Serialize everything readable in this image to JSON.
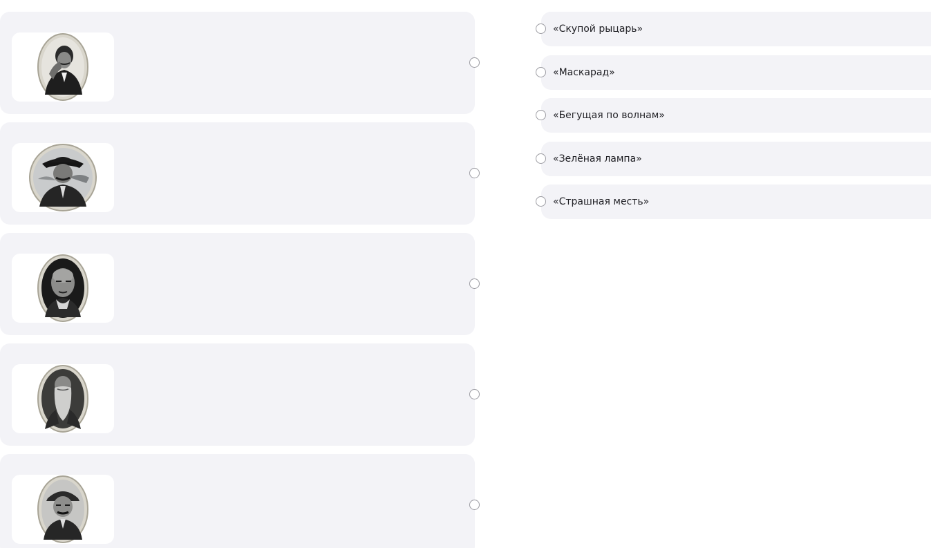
{
  "portraits": [
    {
      "icon": "portrait-man-mustache-hand-on-cheek-icon"
    },
    {
      "icon": "portrait-man-hat-mustache-icon"
    },
    {
      "icon": "portrait-man-bald-icon"
    },
    {
      "icon": "portrait-man-long-beard-icon"
    },
    {
      "icon": "portrait-man-cap-mustache-icon"
    }
  ],
  "options": [
    {
      "label": "«Скупой рыцарь»"
    },
    {
      "label": "«Маскарад»"
    },
    {
      "label": "«Бегущая по волнам»"
    },
    {
      "label": "«Зелёная лампа»"
    },
    {
      "label": "«Страшная месть»"
    }
  ],
  "colors": {
    "card_background": "#f3f3f7",
    "frame_background": "#ffffff",
    "anchor_border": "#9a9aa0",
    "text": "#1f1f24"
  }
}
